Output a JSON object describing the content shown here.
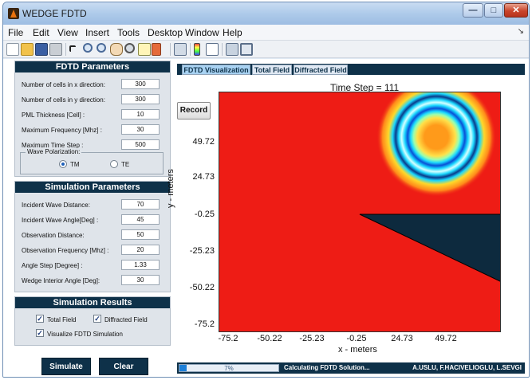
{
  "window": {
    "title": "WEDGE FDTD",
    "minimize": "—",
    "maximize": "□",
    "close": "✕"
  },
  "menu": [
    "File",
    "Edit",
    "View",
    "Insert",
    "Tools",
    "Desktop",
    "Window",
    "Help"
  ],
  "menu_arrow": "↘",
  "toolbar_icons": [
    "new-file-icon",
    "open-file-icon",
    "save-icon",
    "print-icon",
    "select-arrow-icon",
    "zoom-in-icon",
    "zoom-out-icon",
    "pan-icon",
    "rotate-icon",
    "data-cursor-icon",
    "brush-icon",
    "brush-dropdown-icon",
    "link-icon",
    "insert-colorbar-icon",
    "insert-legend-icon",
    "hide-plot-tools-icon",
    "show-plot-tools-icon"
  ],
  "fdtd_parameters": {
    "header": "FDTD Parameters",
    "fields": [
      {
        "label": "Number of cells in x direction:",
        "value": "300"
      },
      {
        "label": "Number of cells in y direction:",
        "value": "300"
      },
      {
        "label": "PML Thickness [Cell] :",
        "value": "10"
      },
      {
        "label": "Maximum Frequency [Mhz] :",
        "value": "30"
      },
      {
        "label": "Maximum Time Step :",
        "value": "500"
      }
    ],
    "polarization": {
      "title": "Wave Polarization:",
      "options": [
        "TM",
        "TE"
      ],
      "selected": "TM"
    }
  },
  "simulation_parameters": {
    "header": "Simulation Parameters",
    "fields": [
      {
        "label": "Incident Wave Distance:",
        "value": "70"
      },
      {
        "label": "Incident Wave Angle[Deg] :",
        "value": "45"
      },
      {
        "label": "Observation Distance:",
        "value": "50"
      },
      {
        "label": "Observation Frequency [Mhz] :",
        "value": "20"
      },
      {
        "label": "Angle Step [Degree] :",
        "value": "1.33"
      },
      {
        "label": "Wedge Interior Angle [Deg]:",
        "value": "30"
      }
    ]
  },
  "simulation_results": {
    "header": "Simulation Results",
    "total_field": {
      "label": "Total Field",
      "checked": true
    },
    "diffracted_field": {
      "label": "Diffracted Field",
      "checked": true
    },
    "visualize": {
      "label": "Visualize FDTD Simulation",
      "checked": true
    },
    "check_mark": "✓"
  },
  "buttons": {
    "simulate": "Simulate",
    "clear": "Clear",
    "record": "Record"
  },
  "tabs": [
    {
      "label": "FDTD Visualization",
      "active": true
    },
    {
      "label": "Total Field",
      "active": false
    },
    {
      "label": "Diffracted Field",
      "active": false
    }
  ],
  "plot": {
    "title": "Time Step = 111",
    "xlabel": "x - meters",
    "ylabel": "y - meters",
    "xticks": [
      "-75.2",
      "-50.22",
      "-25.23",
      "-0.25",
      "24.73",
      "49.72"
    ],
    "yticks": [
      "49.72",
      "24.73",
      "-0.25",
      "-25.23",
      "-50.22",
      "-75.2"
    ],
    "background_color": "#ee1c15",
    "wedge_color": "#0d2a3e"
  },
  "status": {
    "progress_text": "7%",
    "progress_value": 0.07,
    "message": "Calculating FDTD Solution...",
    "credits": "A.USLU, F.HACIVELIOGLU, L.SEVGI"
  },
  "colors": {
    "panel_header": "#0e3149",
    "active_tab": "#a8d2f2"
  }
}
